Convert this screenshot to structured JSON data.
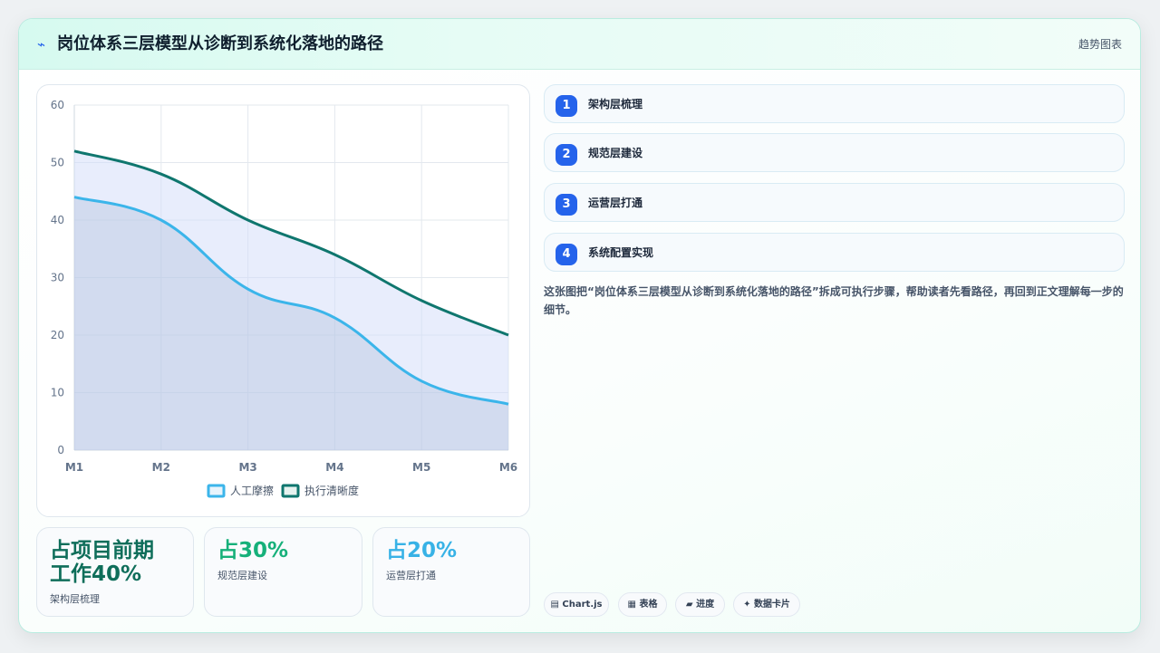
{
  "header": {
    "icon": "chart-icon",
    "title": "岗位体系三层模型从诊断到系统化落地的路径",
    "tag": "趋势图表"
  },
  "chart_data": {
    "type": "area",
    "categories": [
      "M1",
      "M2",
      "M3",
      "M4",
      "M5",
      "M6"
    ],
    "series": [
      {
        "name": "人工摩擦",
        "values": [
          44,
          40,
          28,
          23,
          12,
          8
        ],
        "color": "#3bb5ea",
        "fill": "rgba(160,180,210,0.30)"
      },
      {
        "name": "执行清晰度",
        "values": [
          52,
          48,
          40,
          34,
          26,
          20
        ],
        "color": "#0f766e",
        "fill": "rgba(210,220,250,0.50)"
      }
    ],
    "ylim": [
      0,
      60
    ],
    "yticks": [
      0,
      10,
      20,
      30,
      40,
      50,
      60
    ],
    "grid": true,
    "legend": "bottom"
  },
  "stats": [
    {
      "big": "占项目前期工作40%",
      "line1": "占项目前期",
      "line2": "工作40%",
      "sub": "架构层梳理",
      "color": "#0f6e5a"
    },
    {
      "big": "占30%",
      "sub": "规范层建设",
      "color": "#16b07a"
    },
    {
      "big": "占20%",
      "sub": "运营层打通",
      "color": "#38b2e6"
    }
  ],
  "steps": [
    {
      "num": "1",
      "label": "架构层梳理"
    },
    {
      "num": "2",
      "label": "规范层建设"
    },
    {
      "num": "3",
      "label": "运营层打通"
    },
    {
      "num": "4",
      "label": "系统配置实现"
    }
  ],
  "description": "这张图把“岗位体系三层模型从诊断到系统化落地的路径”拆成可执行步骤，帮助读者先看路径，再回到正文理解每一步的细节。",
  "pills": [
    {
      "icon": "▤",
      "label": "Chart.js"
    },
    {
      "icon": "▦",
      "label": "表格"
    },
    {
      "icon": "▰",
      "label": "进度"
    },
    {
      "icon": "✦",
      "label": "数据卡片"
    }
  ]
}
